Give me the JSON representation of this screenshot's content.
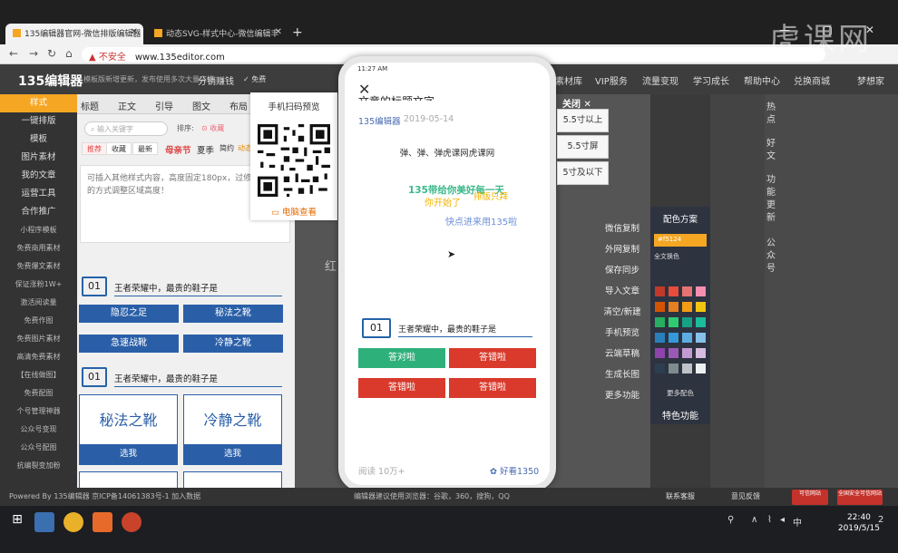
{
  "browser": {
    "tabs": [
      {
        "title": "135编辑器官网-微信排版编辑器"
      },
      {
        "title": "动态SVG-样式中心-微信编辑丰"
      }
    ],
    "new_tab": "+",
    "window_controls": "— ▢ ✕",
    "url_warning": "▲ 不安全",
    "url": "www.135editor.com",
    "watermark": "虎课网"
  },
  "site": {
    "logo": "135编辑器",
    "notice": "模板版新增更新，发布使用多次大量实排",
    "fenxiao": "分销赚钱",
    "free": "✓ 免费",
    "nav": [
      "素材库",
      "VIP服务",
      "流量变现",
      "学习成长",
      "帮助中心",
      "兑换商城"
    ],
    "user": "梦想家"
  },
  "sidebar": {
    "items": [
      {
        "label": "样式",
        "active": true
      },
      {
        "label": "一键排版"
      },
      {
        "label": "模板"
      },
      {
        "label": "图片素材"
      },
      {
        "label": "我的文章"
      },
      {
        "label": "运营工具"
      },
      {
        "label": "合作推广"
      },
      {
        "label": "小程序模板",
        "small": true
      },
      {
        "label": "免费商用素材",
        "small": true
      },
      {
        "label": "免费爆文素材",
        "small": true
      },
      {
        "label": "保证涨粉1W+",
        "small": true
      },
      {
        "label": "激活阅读量",
        "small": true
      },
      {
        "label": "免费作图",
        "small": true
      },
      {
        "label": "免费图片素材",
        "small": true
      },
      {
        "label": "高清免费素材",
        "small": true
      },
      {
        "label": "【在线做图】",
        "small": true
      },
      {
        "label": "免费配图",
        "small": true
      },
      {
        "label": "个号管理神器",
        "small": true
      },
      {
        "label": "公众号变现",
        "small": true
      },
      {
        "label": "公众号配图",
        "small": true
      },
      {
        "label": "抗编裂变加粉",
        "small": true
      }
    ]
  },
  "panel": {
    "tabs": [
      "标题",
      "正文",
      "引导",
      "图文",
      "布局"
    ],
    "search_placeholder": "输入关键字",
    "sort_label": "排序:",
    "sort_fav": "⊙ 收藏",
    "filters": [
      "推荐",
      "收藏",
      "最新",
      "母亲节",
      "夏季",
      "简约",
      "动态"
    ],
    "description": "可插入其他样式内容，高度固定180px，过修改代码的方式调整区域高度！",
    "q1": {
      "num": "01",
      "text": "王者荣耀中，最贵的鞋子是"
    },
    "q1_buttons": [
      "隐忍之足",
      "秘法之靴",
      "急速战靴",
      "冷静之靴"
    ],
    "q2": {
      "num": "01",
      "text": "王者荣耀中，最贵的鞋子是"
    },
    "cards": [
      {
        "title": "秘法之靴",
        "button": "选我"
      },
      {
        "title": "冷静之靴",
        "button": "选我"
      }
    ]
  },
  "qr_popup": {
    "title": "手机扫码预览",
    "pc_view": "电脑查看"
  },
  "background_text": "红",
  "phone": {
    "status_time": "11:27 AM",
    "close": "✕",
    "article_title": "文章的标题文字",
    "author": "135编辑器",
    "date": "2019-05-14",
    "line1": "弹、弹、弹虎课网虎课网",
    "line2": "135带给你美好每一天",
    "line3": "你开始了",
    "line4": "排版只拜",
    "line5": "快点进来用135啦",
    "question": {
      "num": "01",
      "text": "王者荣耀中，最贵的鞋子是"
    },
    "answers": [
      {
        "label": "答对啦",
        "color": "#2eb07a"
      },
      {
        "label": "答错啦",
        "color": "#d93a2b"
      },
      {
        "label": "答错啦",
        "color": "#d93a2b"
      },
      {
        "label": "答错啦",
        "color": "#d93a2b"
      }
    ],
    "reads": "阅读 10万+",
    "likes": "✿ 好看1350"
  },
  "size_panel": {
    "close": "关闭 ✕",
    "options": [
      "5.5寸以上",
      "5.5寸屏",
      "5寸及以下"
    ]
  },
  "right_tools": [
    "微信复制",
    "外网复制",
    "保存同步",
    "导入文章",
    "清空/新建",
    "手机预览",
    "云端草稿",
    "生成长图",
    "更多功能"
  ],
  "color_scheme": {
    "title": "配色方案",
    "hex": "#f5124",
    "full_color": "全文换色",
    "more": "更多配色",
    "special": "特色功能",
    "swatches": [
      "#c0392b",
      "#e74c3c",
      "#e57373",
      "#f48fb1",
      "#d35400",
      "#e67e22",
      "#f39c12",
      "#f1c40f",
      "#27ae60",
      "#2ecc71",
      "#16a085",
      "#1abc9c",
      "#2980b9",
      "#3498db",
      "#5dade2",
      "#85c1e9",
      "#8e44ad",
      "#9b59b6",
      "#c39bd3",
      "#d7bde2",
      "#2c3e50",
      "#7f8c8d",
      "#bdc3c7",
      "#ecf0f1"
    ]
  },
  "right_vertical": [
    "热点",
    "好文",
    "功能更新",
    "公众号"
  ],
  "footer": {
    "powered": "Powered By 135编辑器 京ICP备14061383号-1 加入数据",
    "center": "编辑器建议使用浏览器：谷歌，360，搜狗，QQ",
    "help": "联系客服",
    "feedback": "意见反馈",
    "badge1": "可信网站",
    "badge2": "全国安全可信网站"
  },
  "taskbar": {
    "time": "22:40",
    "date": "2019/5/15",
    "ime": "中",
    "notif": "2"
  }
}
